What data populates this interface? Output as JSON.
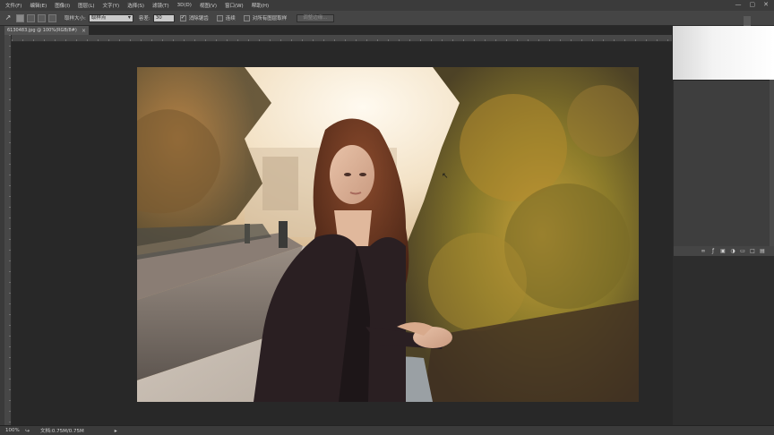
{
  "menubar": {
    "items": [
      "文件(F)",
      "编辑(E)",
      "图像(I)",
      "图层(L)",
      "文字(Y)",
      "选择(S)",
      "滤镜(T)",
      "3D(D)",
      "视图(V)",
      "窗口(W)",
      "帮助(H)"
    ],
    "window_controls": [
      "—",
      "▢",
      "✕"
    ]
  },
  "options": {
    "tool_icon": "lasso-icon",
    "feather_size_label": "取样大小:",
    "feather_size_value": "取样点",
    "tolerance_label": "容差:",
    "tolerance_value": "30",
    "antialias_label": "消除锯齿",
    "antialias_checked": true,
    "contiguous_label": "连续",
    "contiguous_checked": false,
    "all_layers_label": "对所有图层取样",
    "all_layers_checked": false,
    "refine_edge_label": "调整边缘..."
  },
  "document": {
    "tab_title": "6130483.jpg @ 100%(RGB/8#)",
    "tab_close": "×"
  },
  "panel_footer_icons": [
    "link-icon",
    "fx-icon",
    "mask-icon",
    "adjustment-icon",
    "folder-icon",
    "new-layer-icon",
    "trash-icon"
  ],
  "status": {
    "zoom": "100%",
    "doc_info": "文档:0.75M/0.75M",
    "arrow": "▸"
  },
  "colors": {
    "menubar_bg": "#3b3b3b",
    "options_bg": "#454545",
    "canvas_bg": "#282828"
  }
}
